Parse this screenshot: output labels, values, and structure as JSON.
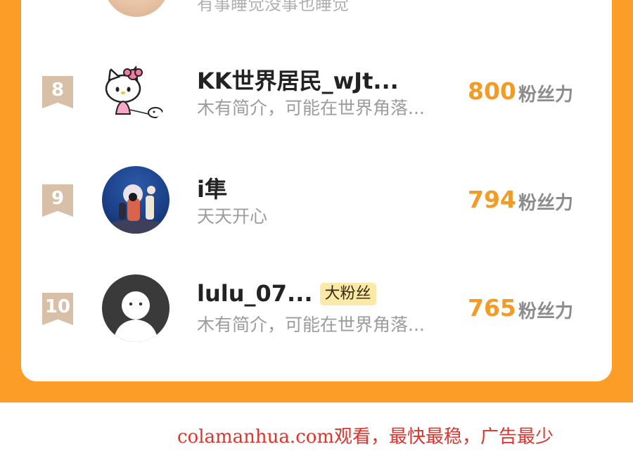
{
  "partial_row": {
    "bio": "有事睡觉没事也睡觉"
  },
  "leaderboard": [
    {
      "rank": "8",
      "name": "KK世界居民_wJt...",
      "bio": "木有简介，可能在世界角落...",
      "count": "800",
      "count_label": "粉丝力",
      "badge": "",
      "avatar_icon": "hello-kitty-icon"
    },
    {
      "rank": "9",
      "name": "i隼",
      "bio": "天天开心",
      "count": "794",
      "count_label": "粉丝力",
      "badge": "",
      "avatar_icon": "night-scene-photo"
    },
    {
      "rank": "10",
      "name": "lulu_07...",
      "bio": "木有简介，可能在世界角落...",
      "count": "765",
      "count_label": "粉丝力",
      "badge": "大粉丝",
      "avatar_icon": "default-user-icon"
    }
  ],
  "watermark": "colamanhua.com观看，最快最稳，广告最少",
  "colors": {
    "background": "#fb9d26",
    "card": "#ffffff",
    "count": "#f39b25",
    "rank_ribbon": "#d7bfa8",
    "badge_bg": "#fbe9a8",
    "watermark": "#e0332c"
  }
}
